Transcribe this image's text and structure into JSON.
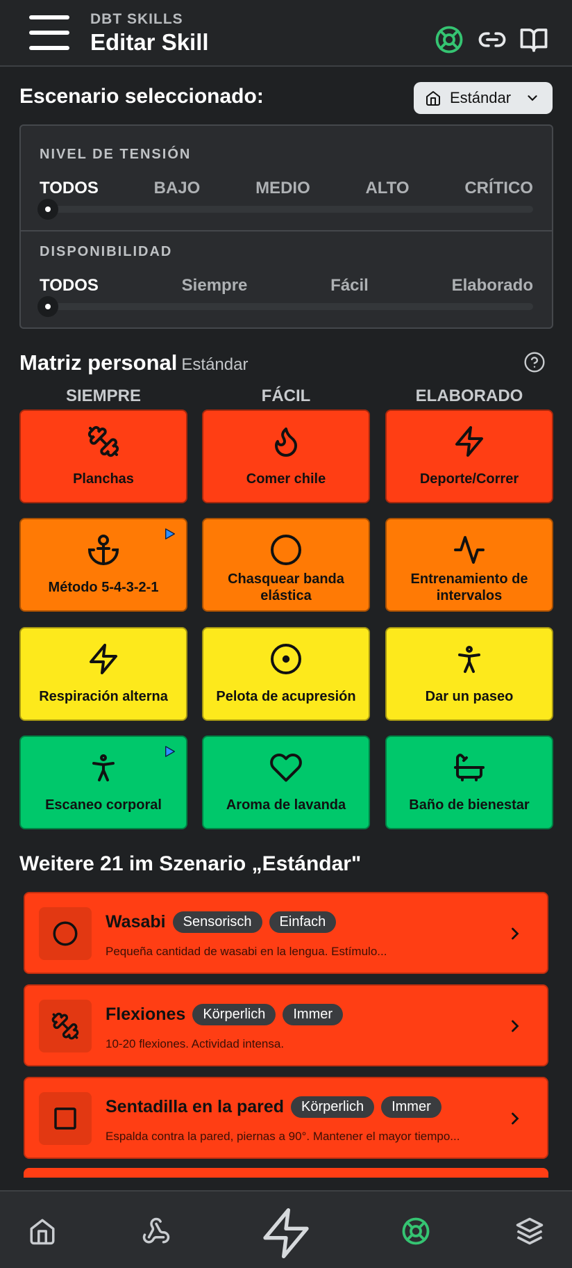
{
  "header": {
    "subtitle": "DBT SKILLS",
    "title": "Editar Skill",
    "icons": [
      "menu-icon",
      "lifebuoy-icon",
      "link-icon",
      "book-icon"
    ],
    "accent_color": "#35c472"
  },
  "scenario": {
    "title": "Escenario seleccionado:",
    "selected": "Estándar",
    "icon": "home-icon"
  },
  "filters": {
    "tension": {
      "label": "NIVEL DE TENSIÓN",
      "options": [
        "TODOS",
        "BAJO",
        "MEDIO",
        "ALTO",
        "CRÍTICO"
      ],
      "selected": "TODOS"
    },
    "availability": {
      "label": "DISPONIBILIDAD",
      "options": [
        "TODOS",
        "Siempre",
        "Fácil",
        "Elaborado"
      ],
      "selected": "TODOS"
    }
  },
  "matrix": {
    "title": "Matriz personal",
    "subtitle": "Estándar",
    "columns": [
      "SIEMPRE",
      "FÁCIL",
      "ELABORADO"
    ],
    "rows": [
      {
        "color": "#ff3e14",
        "tiles": [
          {
            "label": "Planchas",
            "icon": "dumbbell-icon"
          },
          {
            "label": "Comer chile",
            "icon": "flame-icon"
          },
          {
            "label": "Deporte/Correr",
            "icon": "zap-icon"
          }
        ]
      },
      {
        "color": "#ff7a05",
        "tiles": [
          {
            "label": "Método 5-4-3-2-1",
            "icon": "anchor-icon",
            "has_audio": true
          },
          {
            "label": "Chasquear banda elástica",
            "icon": "circle-icon"
          },
          {
            "label": "Entrenamiento de intervalos",
            "icon": "activity-icon"
          }
        ]
      },
      {
        "color": "#fde91c",
        "tiles": [
          {
            "label": "Respiración alterna",
            "icon": "zap-icon"
          },
          {
            "label": "Pelota de acupresión",
            "icon": "target-icon"
          },
          {
            "label": "Dar un paseo",
            "icon": "person-icon"
          }
        ]
      },
      {
        "color": "#00c86b",
        "tiles": [
          {
            "label": "Escaneo corporal",
            "icon": "person-icon",
            "has_audio": true
          },
          {
            "label": "Aroma de lavanda",
            "icon": "heart-icon"
          },
          {
            "label": "Baño de bienestar",
            "icon": "bath-icon"
          }
        ]
      }
    ]
  },
  "more": {
    "title": "Weitere 21 im Szenario „Estándar\"",
    "items": [
      {
        "name": "Wasabi",
        "tags": [
          "Sensorisch",
          "Einfach"
        ],
        "desc": "Pequeña cantidad de wasabi en la lengua. Estímulo...",
        "icon": "circle-icon"
      },
      {
        "name": "Flexiones",
        "tags": [
          "Körperlich",
          "Immer"
        ],
        "desc": "10-20 flexiones. Actividad intensa.",
        "icon": "dumbbell-icon"
      },
      {
        "name": "Sentadilla en la pared",
        "tags": [
          "Körperlich",
          "Immer"
        ],
        "desc": "Espalda contra la pared, piernas a 90°. Mantener el mayor tiempo...",
        "icon": "square-icon"
      }
    ]
  },
  "bottom_nav": [
    "home-icon",
    "webhook-icon",
    "zap-icon",
    "lifebuoy-icon",
    "layers-icon"
  ]
}
